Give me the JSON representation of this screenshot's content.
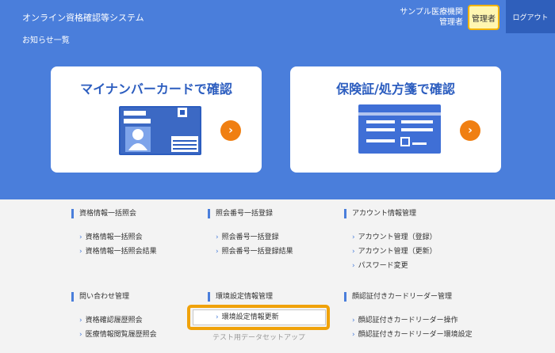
{
  "header": {
    "system_title": "オンライン資格確認等システム",
    "notice_link": "お知らせ一覧",
    "org_name": "サンプル医療機関",
    "org_role": "管理者",
    "admin_badge": "管理者",
    "logout_label": "ログアウト"
  },
  "cards": [
    {
      "title": "マイナンバーカードで確認",
      "icon": "id-card-icon",
      "action_icon": "chevron-right-icon"
    },
    {
      "title": "保険証/処方箋で確認",
      "icon": "document-card-icon",
      "action_icon": "chevron-right-icon"
    }
  ],
  "menu": [
    {
      "heading": "資格情報一括照会",
      "items": [
        "資格情報一括照会",
        "資格情報一括照会結果"
      ]
    },
    {
      "heading": "照会番号一括登録",
      "items": [
        "照会番号一括登録",
        "照会番号一括登録結果"
      ]
    },
    {
      "heading": "アカウント情報管理",
      "items": [
        "アカウント管理（登録）",
        "アカウント管理（更新）",
        "パスワード変更"
      ]
    },
    {
      "heading": "問い合わせ管理",
      "items": [
        "資格確認履歴照会",
        "医療情報閲覧履歴照会"
      ]
    },
    {
      "heading": "環境設定情報管理",
      "items": [
        "環境設定情報更新",
        "テスト用データセットアップ"
      ]
    },
    {
      "heading": "顔認証付きカードリーダー管理",
      "items": [
        "顔認証付きカードリーダー操作",
        "顔認証付きカードリーダー環境設定"
      ]
    }
  ],
  "colors": {
    "hero_blue": "#4a7edb",
    "card_title_blue": "#2c5dbf",
    "action_orange": "#f07f12",
    "highlight_orange": "#f0a20a",
    "admin_yellow": "#fff6b0"
  }
}
